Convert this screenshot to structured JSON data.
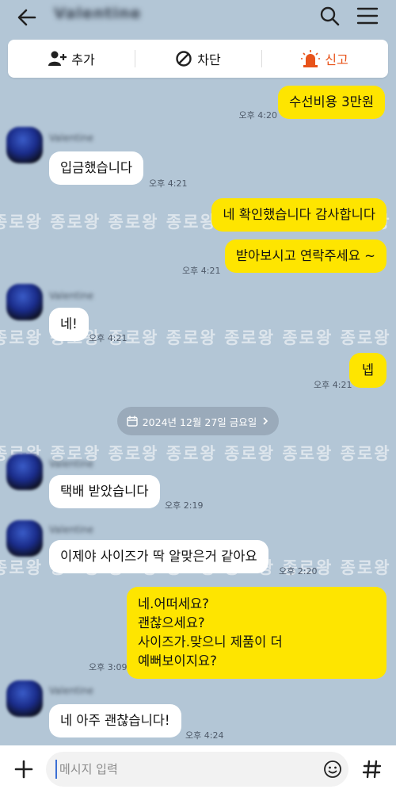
{
  "header": {
    "title": "Valentine",
    "back_icon": "arrow-left-icon",
    "search_icon": "search-icon",
    "menu_icon": "hamburger-menu-icon"
  },
  "actions": {
    "add_label": "추가",
    "block_label": "차단",
    "report_label": "신고",
    "report_color": "#e8531a"
  },
  "watermark": "종로왕 종로왕 종로왕 종로왕 종로왕 종로왕 종로왕",
  "date_divider": "2024년 12월 27일 금요일",
  "messages": [
    {
      "from": "me",
      "text": "수선비용 3만원",
      "time": "오후 4:20"
    },
    {
      "from": "them",
      "sender": "Valentine",
      "text": "입금했습니다",
      "time": "오후 4:21"
    },
    {
      "from": "me",
      "text": "네 확인했습니다 감사합니다",
      "time": ""
    },
    {
      "from": "me",
      "text": "받아보시고 연락주세요 ~",
      "time": "오후 4:21"
    },
    {
      "from": "them",
      "sender": "Valentine",
      "text": "네!",
      "time": "오후 4:21"
    },
    {
      "from": "me",
      "text": "넵",
      "time": "오후 4:21"
    },
    {
      "from": "them",
      "sender": "Valentine",
      "text": "택배 받았습니다",
      "time": "오후 2:19"
    },
    {
      "from": "them",
      "sender": "Valentine",
      "text": "이제야 사이즈가 딱 알맞은거 같아요",
      "time": "오후 2:20"
    },
    {
      "from": "me",
      "text": "네.어떠세요?\n괜찮으세요?\n사이즈가.맞으니 제품이 더\n예뻐보이지요?",
      "time": "오후 3:09"
    },
    {
      "from": "them",
      "sender": "Valentine",
      "text": "네 아주 괜찮습니다!",
      "time": "오후 4:24"
    }
  ],
  "composer": {
    "placeholder": "메시지 입력",
    "plus_icon": "plus-icon",
    "emoji_icon": "emoji-icon",
    "hash_icon": "hash-icon"
  },
  "colors": {
    "background": "#b3c6d6",
    "my_bubble": "#fee500",
    "their_bubble": "#ffffff"
  }
}
